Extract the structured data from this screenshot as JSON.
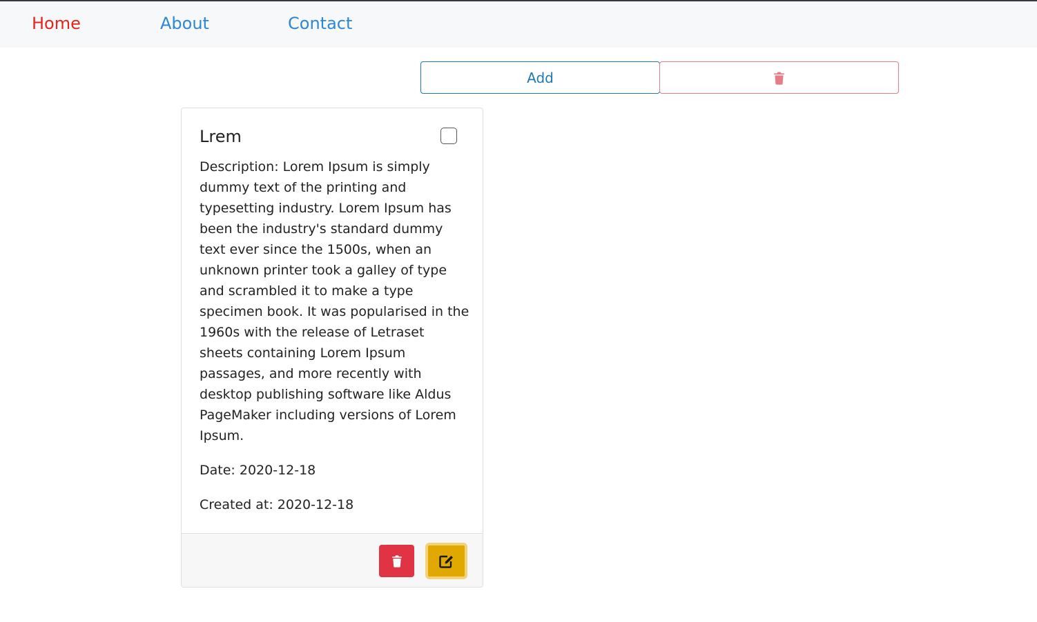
{
  "nav": {
    "home": "Home",
    "about": "About",
    "contact": "Contact"
  },
  "toolbar": {
    "add_label": "Add",
    "delete_icon": "trash-icon"
  },
  "card": {
    "title": "Lrem",
    "description": "Description: Lorem Ipsum is simply dummy text of the printing and typesetting industry. Lorem Ipsum has been the industry's standard dummy text ever since the 1500s, when an unknown printer took a galley of type and scrambled it to make a type specimen book. It was popularised in the 1960s with the release of Letraset sheets containing Lorem Ipsum passages, and more recently with desktop publishing software like Aldus PageMaker including versions of Lorem Ipsum.",
    "date": "Date: 2020-12-18",
    "created_at": "Created at: 2020-12-18",
    "checked": false,
    "footer": {
      "delete_icon": "trash-icon",
      "edit_icon": "edit-icon"
    }
  },
  "colors": {
    "nav_active": "#e8231c",
    "nav_link": "#2c87d8",
    "add_border": "#1f78b4",
    "danger": "#e03343",
    "danger_light": "#e57c86",
    "warning": "#e0a800"
  }
}
